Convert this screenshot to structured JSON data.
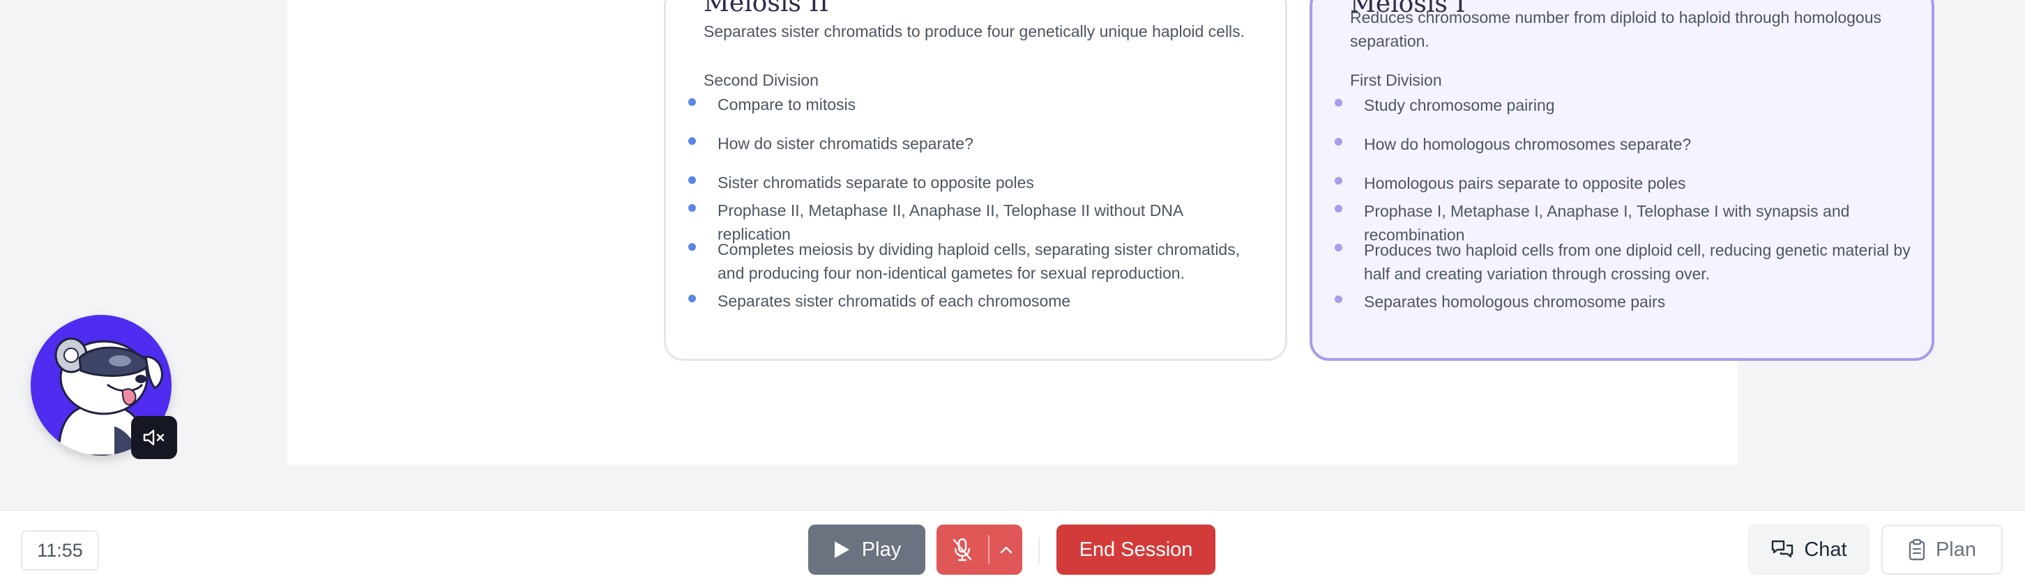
{
  "cards": {
    "meiosis_ii": {
      "title": "Meiosis II",
      "description": "Separates sister chromatids to produce four genetically unique haploid cells.",
      "section_label": "Second Division",
      "bullets": [
        "Compare to mitosis",
        "How do sister chromatids separate?",
        "Sister chromatids separate to opposite poles",
        "Prophase II, Metaphase II, Anaphase II, Telophase II without DNA replication",
        "Completes meiosis by dividing haploid cells, separating sister chromatids, and producing four non-identical gametes for sexual reproduction.",
        "Separates sister chromatids of each chromosome"
      ]
    },
    "meiosis_i": {
      "title": "Meiosis I",
      "description": "Reduces chromosome number from diploid to haploid through homologous separation.",
      "section_label": "First Division",
      "bullets": [
        "Study chromosome pairing",
        "How do homologous chromosomes separate?",
        "Homologous pairs separate to opposite poles",
        "Prophase I, Metaphase I, Anaphase I, Telophase I with synapsis and recombination",
        "Produces two haploid cells from one diploid cell, reducing genetic material by half and creating variation through crossing over.",
        "Separates homologous chromosome pairs"
      ]
    }
  },
  "bottom_bar": {
    "timer": "11:55",
    "play_label": "Play",
    "end_session_label": "End Session",
    "chat_label": "Chat",
    "plan_label": "Plan"
  },
  "colors": {
    "end_session": "#d33b3b",
    "mic_muted": "#e05757",
    "play": "#6b7280",
    "active_card_border": "#a89be8",
    "avatar_bg": "#4f2cf0"
  },
  "icons": [
    "play-icon",
    "mic-off-icon",
    "chevron-up-icon",
    "chat-icon",
    "clipboard-icon",
    "speaker-muted-icon"
  ]
}
